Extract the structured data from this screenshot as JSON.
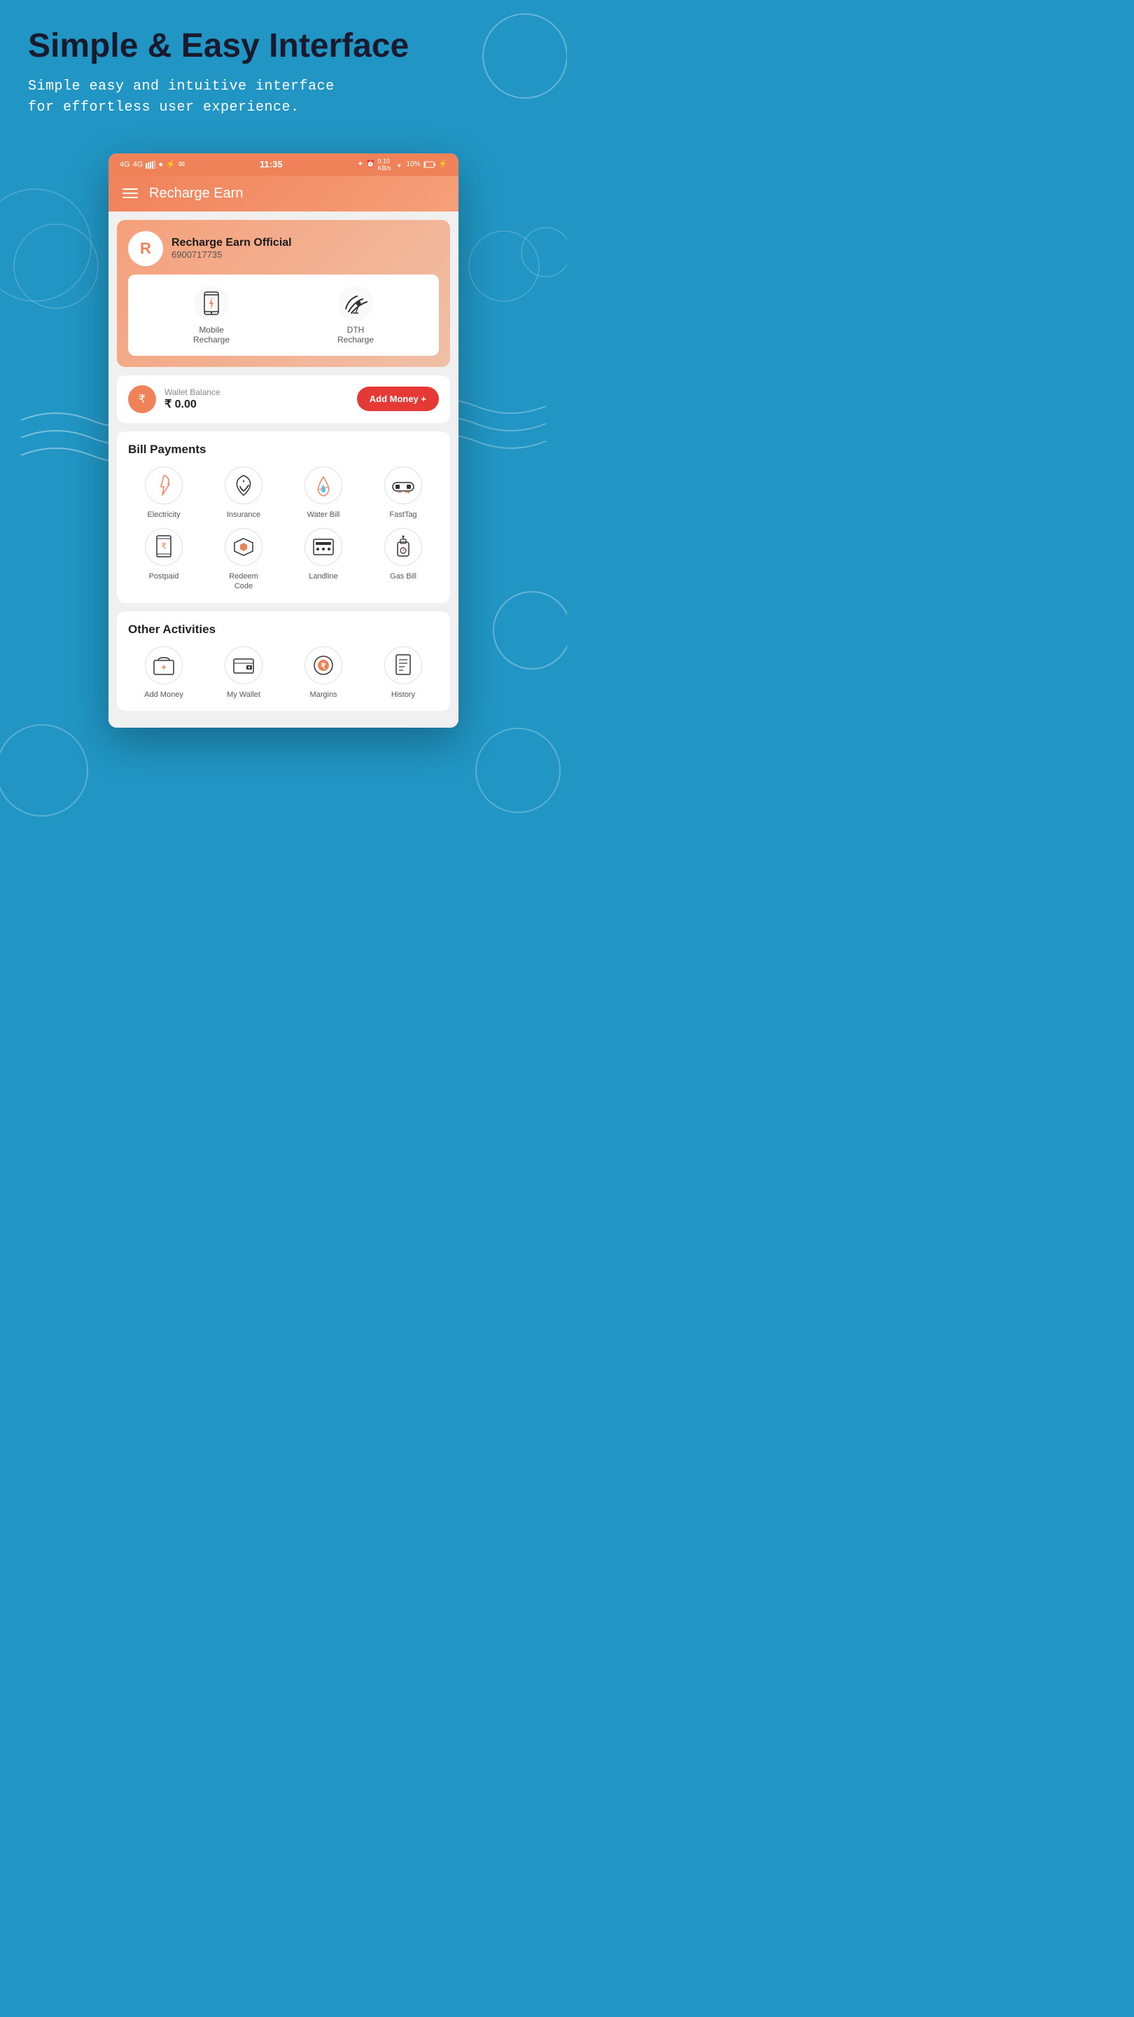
{
  "page": {
    "title": "Simple & Easy Interface",
    "subtitle": "Simple easy and intuitive interface\n    for effortless user experience.",
    "bg_color": "#2196C4"
  },
  "status_bar": {
    "left": "4G  4G  11:35  ●  ψ  ✉  ∂",
    "time": "11:35",
    "right": "✦  ⏰  📶 0.10 KB/s  WiFi  10%  🔋"
  },
  "app_bar": {
    "title": "Recharge Earn"
  },
  "profile": {
    "avatar_letter": "R",
    "name": "Recharge Earn Official",
    "phone": "6900717735"
  },
  "recharge_options": [
    {
      "label": "Mobile\nRecharge",
      "icon": "mobile"
    },
    {
      "label": "DTH\nRecharge",
      "icon": "dth"
    }
  ],
  "wallet": {
    "balance_label": "Wallet Balance",
    "balance_amount": "₹ 0.00",
    "add_money_label": "Add Money +"
  },
  "bill_payments": {
    "section_title": "Bill Payments",
    "items": [
      {
        "label": "Electricity",
        "icon": "bulb"
      },
      {
        "label": "Insurance",
        "icon": "shield"
      },
      {
        "label": "Water Bill",
        "icon": "water"
      },
      {
        "label": "FastTag",
        "icon": "car"
      },
      {
        "label": "Postpaid",
        "icon": "postpaid"
      },
      {
        "label": "Redeem\nCode",
        "icon": "play"
      },
      {
        "label": "Landline",
        "icon": "landline"
      },
      {
        "label": "Gas Bill",
        "icon": "gas"
      }
    ]
  },
  "other_activities": {
    "section_title": "Other Activities",
    "items": [
      {
        "label": "Add Money",
        "icon": "wallet"
      },
      {
        "label": "My Wallet",
        "icon": "mywallet"
      },
      {
        "label": "Margins",
        "icon": "margins"
      },
      {
        "label": "History",
        "icon": "history"
      }
    ]
  }
}
